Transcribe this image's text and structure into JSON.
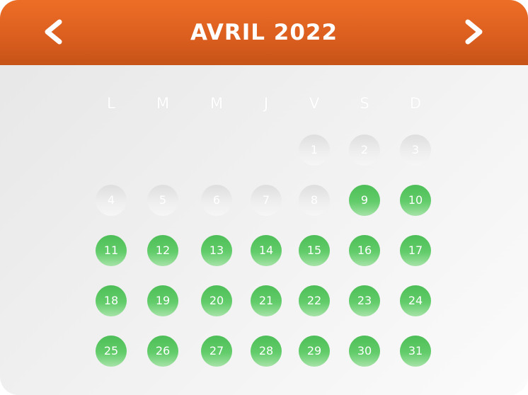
{
  "header": {
    "title": "AVRIL 2022",
    "prev_icon": "chevron-left-icon",
    "next_icon": "chevron-right-icon"
  },
  "weekdays": [
    "L",
    "M",
    "M",
    "J",
    "V",
    "S",
    "D"
  ],
  "days": [
    {
      "label": "1",
      "available": false
    },
    {
      "label": "2",
      "available": false
    },
    {
      "label": "3",
      "available": false
    },
    {
      "label": "4",
      "available": false
    },
    {
      "label": "5",
      "available": false
    },
    {
      "label": "6",
      "available": false
    },
    {
      "label": "7",
      "available": false
    },
    {
      "label": "8",
      "available": false
    },
    {
      "label": "9",
      "available": true
    },
    {
      "label": "10",
      "available": true
    },
    {
      "label": "11",
      "available": true
    },
    {
      "label": "12",
      "available": true
    },
    {
      "label": "13",
      "available": true
    },
    {
      "label": "14",
      "available": true
    },
    {
      "label": "15",
      "available": true
    },
    {
      "label": "16",
      "available": true
    },
    {
      "label": "17",
      "available": true
    },
    {
      "label": "18",
      "available": true
    },
    {
      "label": "19",
      "available": true
    },
    {
      "label": "20",
      "available": true
    },
    {
      "label": "21",
      "available": true
    },
    {
      "label": "22",
      "available": true
    },
    {
      "label": "23",
      "available": true
    },
    {
      "label": "24",
      "available": true
    },
    {
      "label": "25",
      "available": true
    },
    {
      "label": "26",
      "available": true
    },
    {
      "label": "27",
      "available": true
    },
    {
      "label": "28",
      "available": true
    },
    {
      "label": "29",
      "available": true
    },
    {
      "label": "30",
      "available": true
    },
    {
      "label": "31",
      "available": true
    }
  ],
  "colors": {
    "header": "#dc5f1f",
    "available_day": "#5ac663",
    "unavailable_day": "#e6e6e6"
  }
}
